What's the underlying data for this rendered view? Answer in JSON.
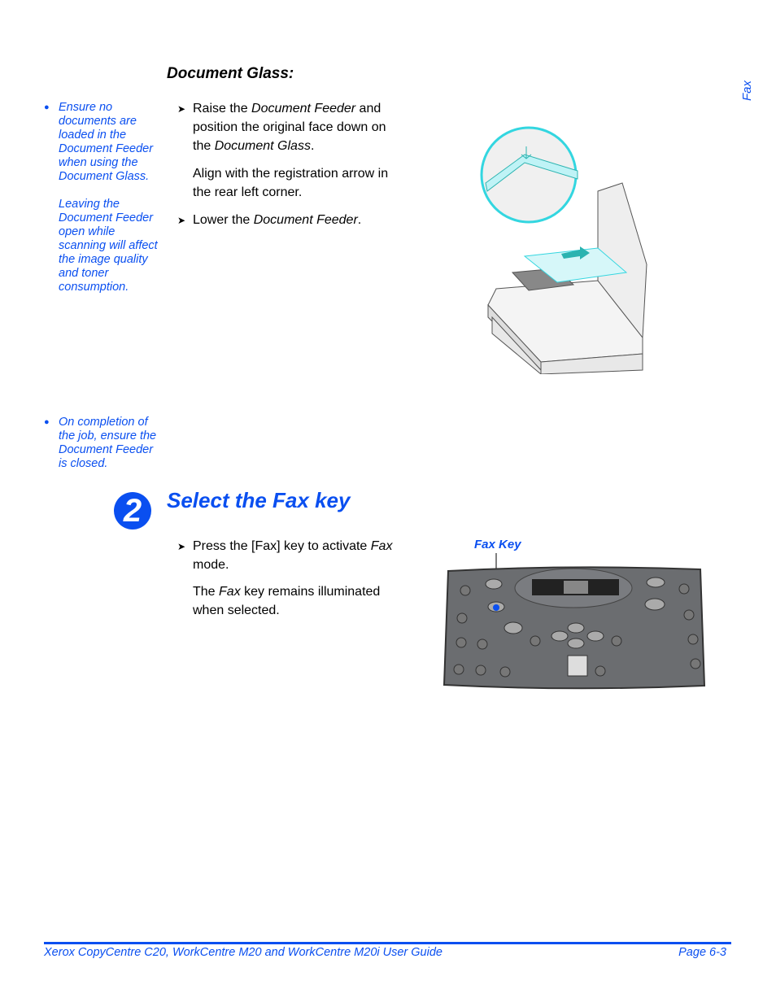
{
  "side_tab": "Fax",
  "section1": {
    "heading": "Document Glass:",
    "notes": [
      "Ensure no documents are loaded in the Document Feeder when using the Document Glass.",
      "Leaving the Document Feeder open while scanning will affect the image quality and toner consumption."
    ],
    "note2": "On completion of the job, ensure the Document Feeder is closed.",
    "step1": {
      "pre": "Raise the ",
      "em1": "Document Feeder",
      "mid": " and position the original face down on the ",
      "em2": "Document Glass",
      "post": "."
    },
    "align_text": "Align with the registration arrow in the rear left corner.",
    "step2": {
      "pre": "Lower the ",
      "em": "Document Feeder",
      "post": "."
    }
  },
  "section2": {
    "number": "2",
    "title": "Select the Fax key",
    "step": {
      "pre": "Press the [Fax] key to activate ",
      "em": "Fax",
      "post": " mode."
    },
    "para": {
      "pre": "The ",
      "em": "Fax",
      "post": " key remains illuminated when selected."
    },
    "callout": "Fax Key"
  },
  "footer": {
    "guide_title": "Xerox CopyCentre C20, WorkCentre M20 and WorkCentre M20i User Guide",
    "page": "Page 6-3"
  },
  "colors": {
    "accent": "#0a4ff0",
    "highlight": "#33d6e0",
    "panel": "#6b6d70"
  },
  "icons": {
    "bullet": "filled-circle",
    "step_arrow": "chevron-right"
  }
}
